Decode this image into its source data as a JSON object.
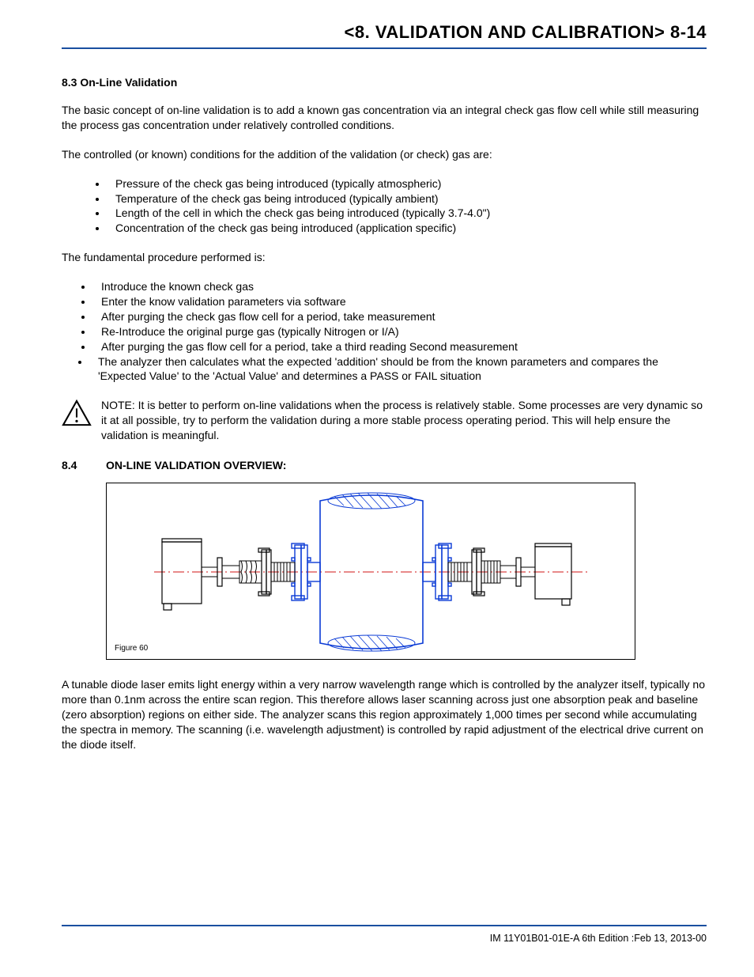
{
  "header": {
    "title": "<8. VALIDATION AND CALIBRATION>  8-14"
  },
  "s83": {
    "heading": "8.3  On-Line Validation",
    "p1": "The basic concept of on-line validation is to add a known gas concentration via an integral check gas flow cell while still measuring the process gas concentration under relatively controlled conditions.",
    "p2": "The controlled (or known) conditions for the addition of the validation (or check) gas are:",
    "list1": [
      "Pressure of the check gas being introduced (typically atmospheric)",
      "Temperature of the check gas being introduced (typically ambient)",
      "Length of the cell in which the check gas being introduced (typically 3.7-4.0\")",
      "Concentration of the check gas being introduced (application specific)"
    ],
    "p3": "The fundamental procedure performed is:",
    "list2": [
      "Introduce the known check gas",
      "Enter the know validation parameters via software",
      "After purging the check gas flow cell for a period, take measurement",
      "Re-Introduce the original purge gas (typically Nitrogen or I/A)",
      " After purging the gas flow cell for a period, take a third reading Second measurement",
      "The analyzer then calculates what the expected 'addition' should be from the known parameters and compares the 'Expected Value' to the 'Actual Value' and determines a PASS or FAIL situation"
    ],
    "note": "NOTE: It is better to perform on-line validations when the process is relatively stable. Some processes are very dynamic so it at all possible, try to perform the validation during a more stable process operating period. This will help ensure the validation is meaningful."
  },
  "s84": {
    "num": "8.4",
    "heading": "ON-LINE VALIDATION OVERVIEW:",
    "figure_caption": "Figure 60",
    "p1": "A tunable diode laser emits light energy within a very narrow wavelength range which is controlled by the analyzer itself, typically no more than 0.1nm across the entire scan region. This therefore allows laser scanning across just one absorption peak and baseline (zero absorption) regions on either side. The analyzer scans this region approximately 1,000 times per second while accumulating the spectra in memory. The scanning (i.e. wavelength adjustment) is controlled by rapid adjustment of the electrical drive current on the diode itself."
  },
  "footer": {
    "text": "IM 11Y01B01-01E-A    6th Edition :Feb 13, 2013-00"
  }
}
